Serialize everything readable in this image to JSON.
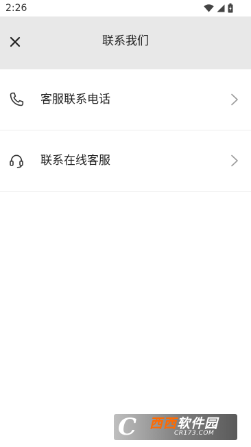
{
  "status_bar": {
    "time": "2:26",
    "icons": [
      "wifi-icon",
      "cell-signal-icon",
      "battery-charging-icon"
    ]
  },
  "app_bar": {
    "title": "联系我们",
    "close_icon": "close-icon"
  },
  "contact_items": [
    {
      "label": "客服联系电话",
      "icon": "phone-icon",
      "trailing_icon": "chevron-right-icon"
    },
    {
      "label": "联系在线客服",
      "icon": "headset-icon",
      "trailing_icon": "chevron-right-icon"
    }
  ],
  "watermark": {
    "mark": "C",
    "brand": "西西",
    "brand_suffix": "软件园",
    "url": "CR173.COM"
  },
  "colors": {
    "app_bar_bg": "#e8e8e8",
    "text": "#222222",
    "divider": "#ececec",
    "watermark_accent": "#ff6a00"
  }
}
